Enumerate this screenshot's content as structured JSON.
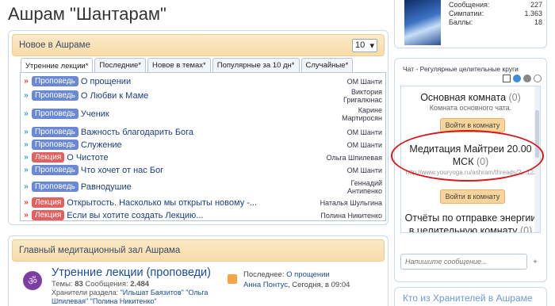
{
  "page_title": "Ашрам \"Шантарам\"",
  "new_block": {
    "title": "Новое в Ашраме",
    "count_value": "10",
    "tabs": [
      "Утренние лекции*",
      "Последние*",
      "Новое в темах*",
      "Популярные за 10 дн*",
      "Случайные*"
    ],
    "threads": [
      {
        "badge": "Проповедь",
        "title": "О прощении",
        "author": "ОМ Шанти"
      },
      {
        "badge": "Проповедь",
        "title": "О Любви к Маме",
        "author": "Виктория Григалюнас"
      },
      {
        "badge": "Проповедь",
        "title": "Ученик",
        "author": "Карине Мартиросян"
      },
      {
        "badge": "Проповедь",
        "title": "Важность благодарить Бога",
        "author": "ОМ Шанти"
      },
      {
        "badge": "Проповедь",
        "title": "Служение",
        "author": "ОМ Шанти"
      },
      {
        "badge": "Лекция",
        "title": "О Чистоте",
        "author": "Ольга Шпилевая"
      },
      {
        "badge": "Проповедь",
        "title": "Что хочет от нас Бог",
        "author": "ОМ Шанти"
      },
      {
        "badge": "Проповедь",
        "title": "Равнодушие",
        "author": "Геннадий Антипенко"
      },
      {
        "badge": "Лекция",
        "title": "Открытость. Насколько мы открыты новому -...",
        "author": "Наталья Шульгина"
      },
      {
        "badge": "Лекция",
        "title": "Если вы хотите создать Лекцию...",
        "author": "Полина Никитенко"
      }
    ]
  },
  "hall_block": {
    "title": "Главный медитационный зал Ашрама",
    "forum_title": "Утренние лекции (проповеди)",
    "topics_label": "Темы:",
    "topics": "83",
    "messages_label": "Сообщения:",
    "messages": "2.484",
    "keepers_label": "Хранители раздела:",
    "keepers": "\"Ильшат Баязитов\" \"Ольга Шпилевая\" \"Полина Никитенко\"",
    "last_label": "Последнее:",
    "last_title": "О прощении",
    "last_author": "Анна Понтус",
    "last_time": "Сегодня, в 09:04"
  },
  "profile": {
    "stats": [
      {
        "label": "Сообщения:",
        "value": "227"
      },
      {
        "label": "Симпатии:",
        "value": "1.363"
      },
      {
        "label": "Баллы:",
        "value": "18"
      }
    ]
  },
  "chat": {
    "title": "Чат - Регулярные целительные круги",
    "rooms": [
      {
        "name": "Основная комната",
        "count": "(0)",
        "desc": "Комната основного чата.",
        "button": "Войти в комнату"
      },
      {
        "name": "Медитация Майтреи 20.00 МСК",
        "count": "(0)",
        "desc": "http://www.youryoga.ru/ashram/threads/2...12/",
        "button": "Войти в комнату"
      },
      {
        "name": "Отчёты по отправке энергии в целительную комнату",
        "count": "(0)"
      }
    ],
    "input_placeholder": "Напишите сообщение...",
    "send_label": "+"
  },
  "keepers_block": {
    "title": "Кто из Хранителей в Ашраме"
  },
  "colors": {
    "badge_blue": "#6a88d8",
    "badge_red": "#e26060",
    "link": "#1c3e7e",
    "highlight": "#d7191c"
  }
}
